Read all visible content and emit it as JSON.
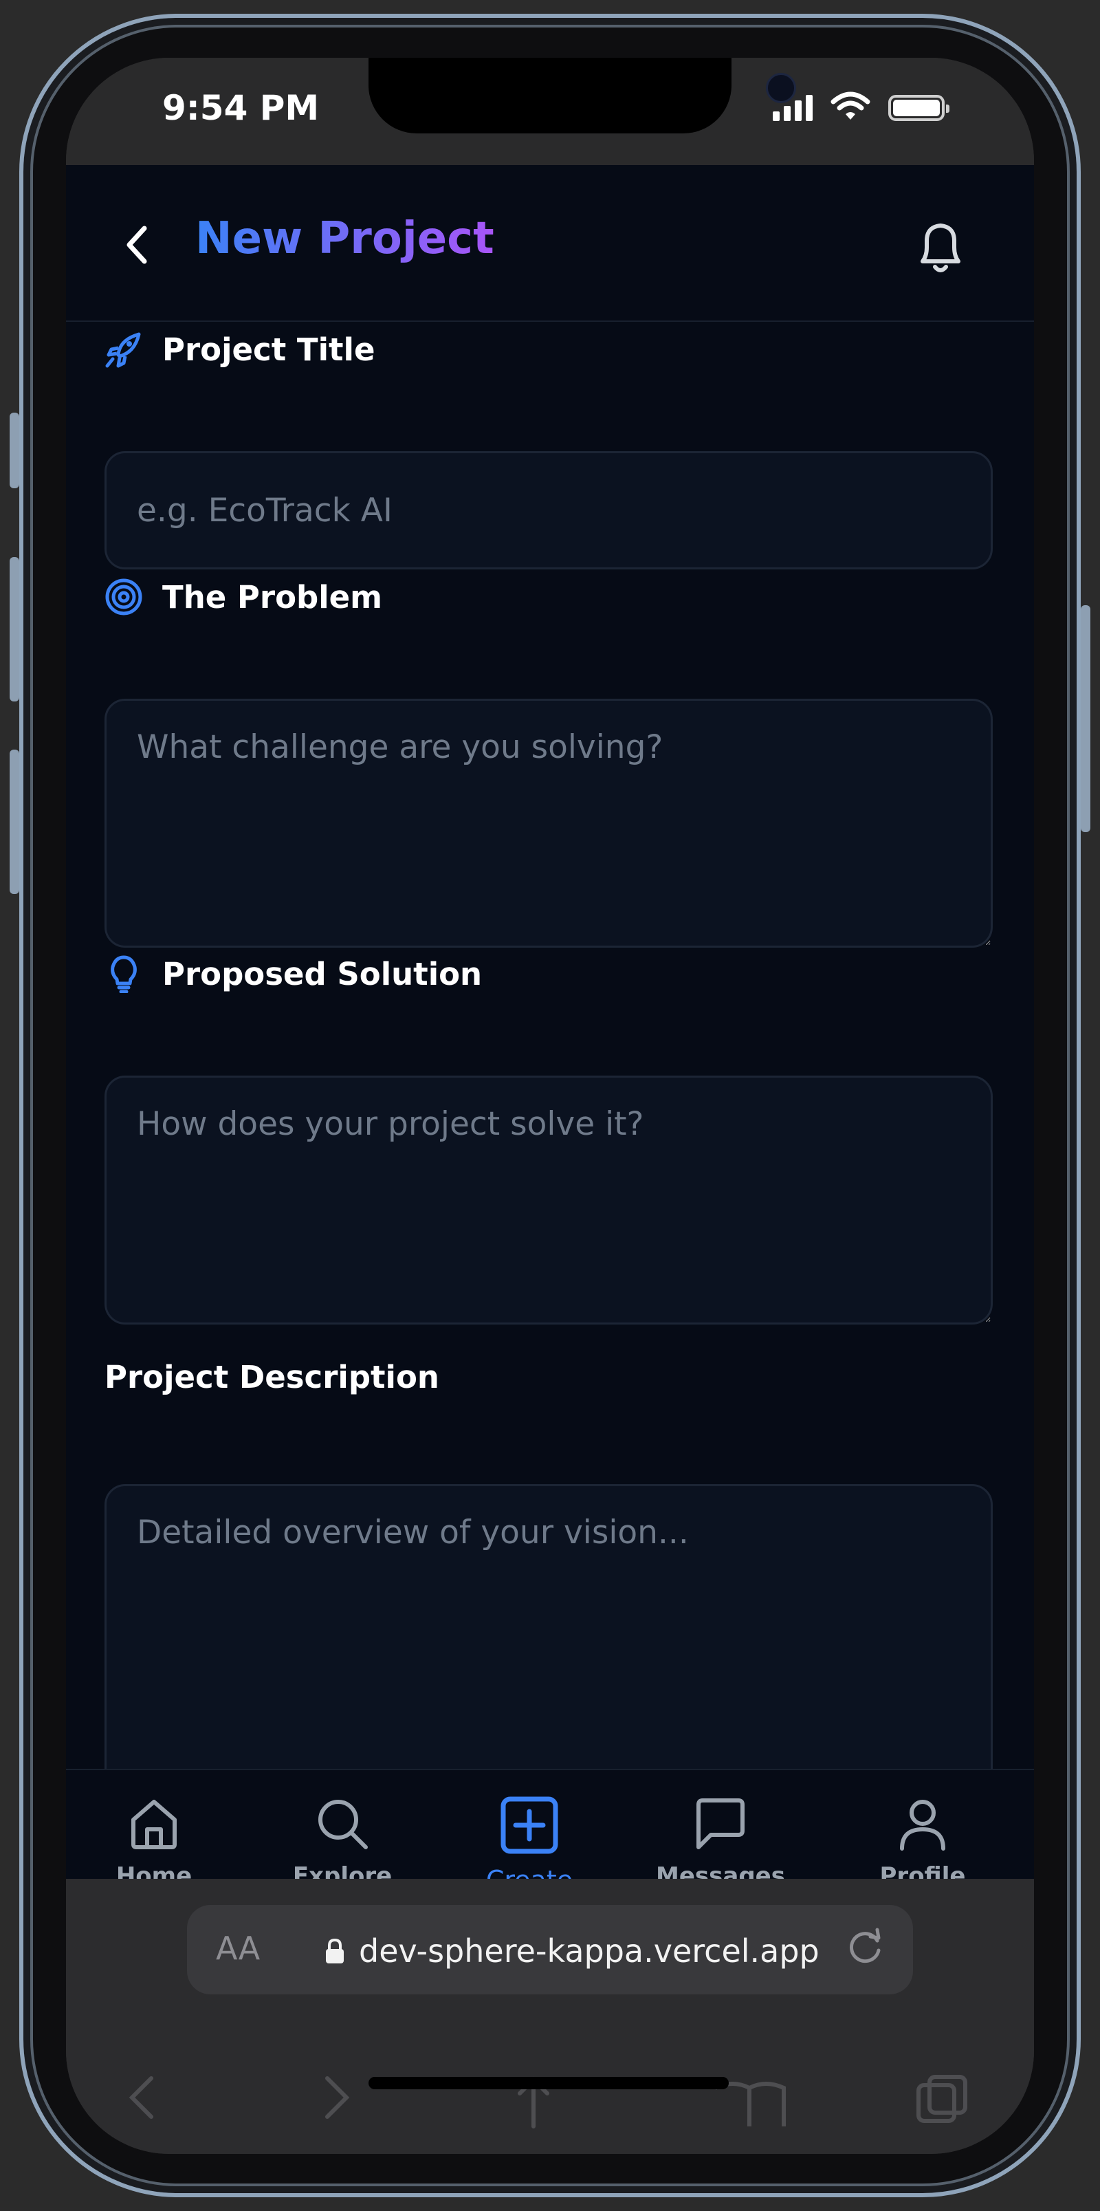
{
  "status": {
    "time": "9:54 PM"
  },
  "header": {
    "title": "New Project"
  },
  "form": {
    "project_title": {
      "label": "Project Title",
      "placeholder": "e.g. EcoTrack AI"
    },
    "problem": {
      "label": "The Problem",
      "placeholder": "What challenge are you solving?"
    },
    "solution": {
      "label": "Proposed Solution",
      "placeholder": "How does your project solve it?"
    },
    "description": {
      "label": "Project Description",
      "placeholder": "Detailed overview of your vision..."
    }
  },
  "nav": {
    "items": [
      {
        "label": "Home",
        "icon": "home-icon"
      },
      {
        "label": "Explore",
        "icon": "search-icon"
      },
      {
        "label": "Create",
        "icon": "plus-square-icon",
        "active": true
      },
      {
        "label": "Messages",
        "icon": "message-icon"
      },
      {
        "label": "Profile",
        "icon": "user-icon"
      }
    ]
  },
  "browser": {
    "aa_label": "AA",
    "url": "dev-sphere-kappa.vercel.app"
  },
  "colors": {
    "accent": "#3b82f6",
    "gradient_end": "#a855f7",
    "background": "#060b16"
  }
}
